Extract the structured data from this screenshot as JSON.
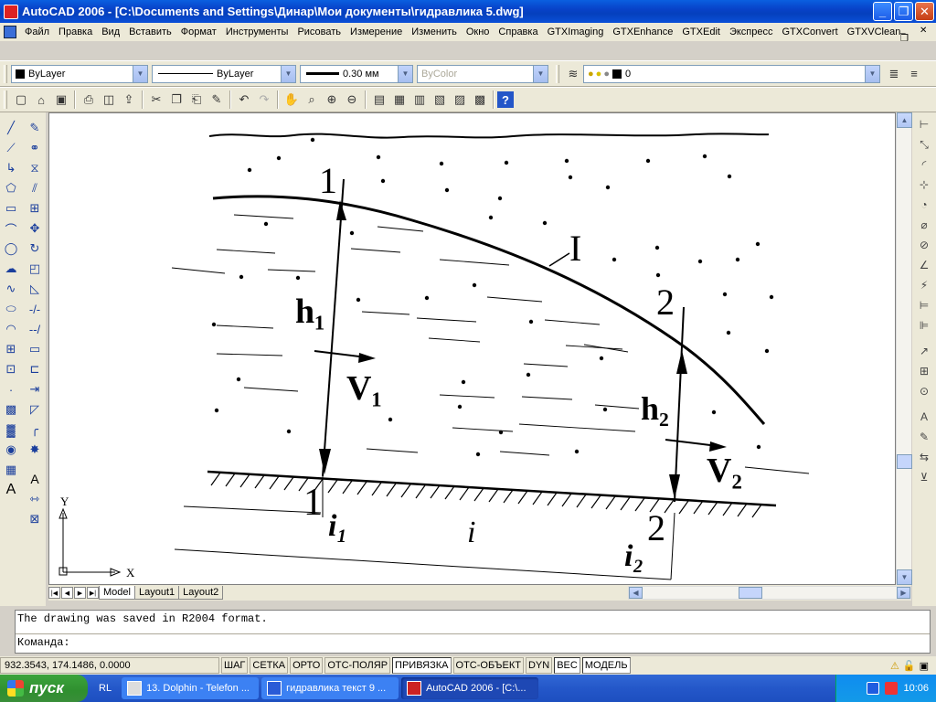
{
  "window": {
    "title": "AutoCAD 2006 - [C:\\Documents and Settings\\Динар\\Мои документы\\гидравлика 5.dwg]",
    "minimize": "_",
    "maximize": "❐",
    "close": "✕"
  },
  "menu": {
    "items": [
      "Файл",
      "Правка",
      "Вид",
      "Вставить",
      "Формат",
      "Инструменты",
      "Рисовать",
      "Измерение",
      "Изменить",
      "Окно",
      "Справка",
      "GTXImaging",
      "GTXEnhance",
      "GTXEdit",
      "Экспресс",
      "GTXConvert",
      "GTXVClean"
    ],
    "mdi_buttons": [
      "_",
      "❐",
      "✕"
    ]
  },
  "properties": {
    "color": "ByLayer",
    "linetype": "ByLayer",
    "lineweight": "0.30 мм",
    "plotstyle": "ByColor",
    "layer": "0"
  },
  "drawing": {
    "labels": {
      "section1_top": "1",
      "section2_top": "2",
      "section1_bottom": "1",
      "section2_bottom": "2",
      "curve_label": "I",
      "h1": "h₁",
      "h2": "h₂",
      "v1": "V₁",
      "v2": "V₂",
      "i1": "i₁",
      "i": "i",
      "i2": "i₂",
      "ucs_x": "X",
      "ucs_y": "Y"
    }
  },
  "tabs": {
    "items": [
      "Model",
      "Layout1",
      "Layout2"
    ],
    "active": "Model"
  },
  "command": {
    "history": "The drawing was saved in R2004 format.",
    "prompt": "Команда:"
  },
  "status": {
    "coords": "932.3543, 174.1486, 0.0000",
    "buttons": [
      "ШАГ",
      "СЕТКА",
      "ОРТО",
      "ОТС-ПОЛЯР",
      "ПРИВЯЗКА",
      "ОТС-ОБЪЕКТ",
      "DYN",
      "ВЕС",
      "МОДЕЛЬ"
    ],
    "active_buttons": [
      "ПРИВЯЗКА",
      "ВЕС",
      "МОДЕЛЬ"
    ]
  },
  "taskbar": {
    "start": "пуск",
    "quicklaunch": "RL",
    "tasks": [
      "13. Dolphin - Telefon ...",
      "гидравлика текст 9 ...",
      "AutoCAD 2006 - [C:\\..."
    ],
    "active_task": "AutoCAD 2006 - [C:\\...",
    "clock": "10:06"
  }
}
